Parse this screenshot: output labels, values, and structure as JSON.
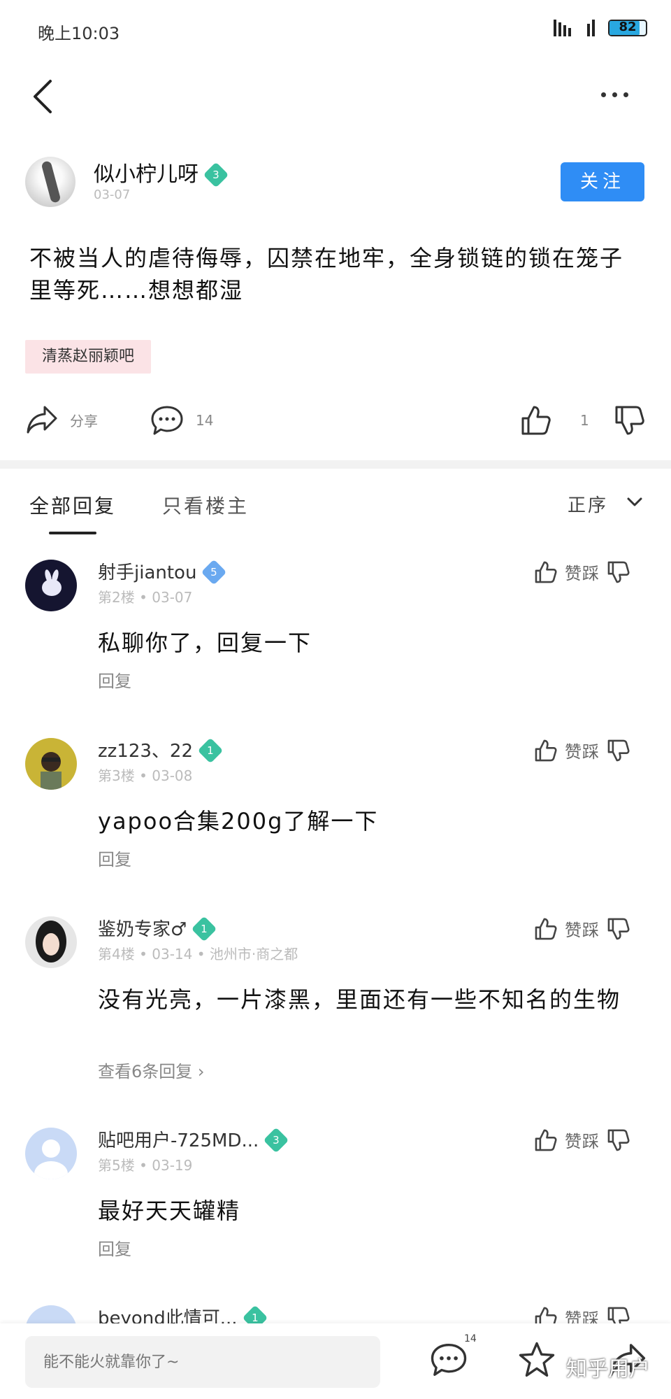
{
  "status_bar": {
    "time": "晚上10:03",
    "battery": "82",
    "battery_level": 0.82
  },
  "post": {
    "author": "似小柠儿呀",
    "level": "3",
    "date": "03-07",
    "follow_label": "关注",
    "text": "不被当人的虐待侮辱，囚禁在地牢，全身锁链的锁在笼子里等死……想想都湿",
    "tag": "清蒸赵丽颖吧",
    "share_label": "分享",
    "comment_count": "14",
    "like_count": "1"
  },
  "tabs": {
    "all": "全部回复",
    "op_only": "只看楼主",
    "sort": "正序"
  },
  "vote_label": "赞踩",
  "comments": [
    {
      "name": "射手jiantou",
      "level": "5",
      "floor": "第2楼",
      "date": "03-07",
      "location": "",
      "text": "私聊你了，回复一下",
      "reply": "回复",
      "avatar_color": "#1a1a3a"
    },
    {
      "name": "zz123、22",
      "level": "1",
      "floor": "第3楼",
      "date": "03-08",
      "location": "",
      "text": "yapoo合集200g了解一下",
      "reply": "回复",
      "avatar_color": "#8a7a30"
    },
    {
      "name": "鉴奶专家♂",
      "level": "1",
      "floor": "第4楼",
      "date": "03-14",
      "location": "池州市·商之都",
      "text": "没有光亮，一片漆黑，里面还有一些不知名的生物",
      "reply": "查看6条回复",
      "avatar_color": "#2a2a2a"
    },
    {
      "name": "贴吧用户-725MD...",
      "level": "3",
      "floor": "第5楼",
      "date": "03-19",
      "location": "",
      "text": "最好天天罐精",
      "reply": "回复",
      "avatar_color": "#c8dcf8"
    },
    {
      "name": "beyond此情可...",
      "level": "1",
      "floor": "",
      "date": "",
      "location": "",
      "text": "",
      "reply": "",
      "avatar_color": "#c8dcf8"
    }
  ],
  "bottom_bar": {
    "placeholder": "能不能火就靠你了~",
    "comment_count": "14",
    "watermark": "知乎用户"
  }
}
